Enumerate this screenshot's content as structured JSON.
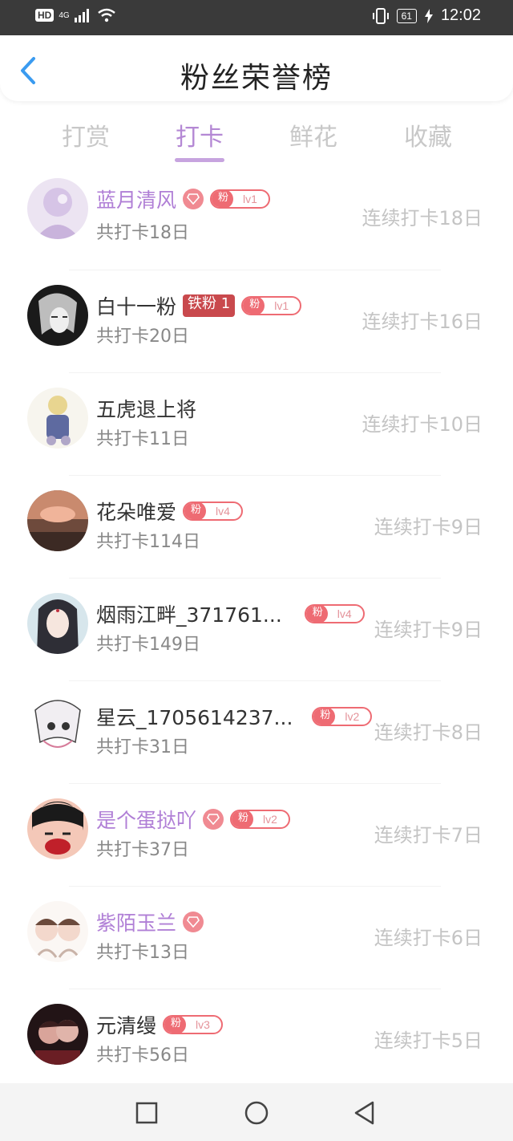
{
  "status_bar": {
    "hd_badge": "HD",
    "network": "4G",
    "battery": "61",
    "time": "12:02"
  },
  "header": {
    "title": "粉丝荣誉榜",
    "back_icon": "back-chevron-icon",
    "accent_color": "#3a9bf0"
  },
  "tabs": [
    {
      "label": "打赏"
    },
    {
      "label": "打卡"
    },
    {
      "label": "鲜花"
    },
    {
      "label": "收藏"
    }
  ],
  "active_tab": "打卡",
  "rows": [
    {
      "name": "蓝月清风",
      "name_color": "purple",
      "diamond": true,
      "fan_label": "粉",
      "fan_level": "lv1",
      "total": "共打卡18日",
      "streak": "连续打卡18日"
    },
    {
      "name": "白十一粉",
      "name_color": "normal",
      "tag": "铁粉 1",
      "fan_label": "粉",
      "fan_level": "lv1",
      "total": "共打卡20日",
      "streak": "连续打卡16日"
    },
    {
      "name": "五虎退上将",
      "name_color": "normal",
      "total": "共打卡11日",
      "streak": "连续打卡10日"
    },
    {
      "name": "花朵唯爱",
      "name_color": "normal",
      "fan_label": "粉",
      "fan_level": "lv4",
      "total": "共打卡114日",
      "streak": "连续打卡9日"
    },
    {
      "name": "烟雨江畔_371761...",
      "name_color": "normal",
      "fan_label": "粉",
      "fan_level": "lv4",
      "total": "共打卡149日",
      "streak": "连续打卡9日"
    },
    {
      "name": "星云_1705614237...",
      "name_color": "normal",
      "fan_label": "粉",
      "fan_level": "lv2",
      "total": "共打卡31日",
      "streak": "连续打卡8日"
    },
    {
      "name": "是个蛋挞吖",
      "name_color": "purple",
      "diamond": true,
      "fan_label": "粉",
      "fan_level": "lv2",
      "total": "共打卡37日",
      "streak": "连续打卡7日"
    },
    {
      "name": "紫陌玉兰",
      "name_color": "purple",
      "diamond": true,
      "total": "共打卡13日",
      "streak": "连续打卡6日"
    },
    {
      "name": "元清缦",
      "name_color": "normal",
      "fan_label": "粉",
      "fan_level": "lv3",
      "total": "共打卡56日",
      "streak": "连续打卡5日"
    }
  ],
  "nav_bar": {
    "recent_icon": "square-recent-icon",
    "home_icon": "circle-home-icon",
    "back_icon": "triangle-back-icon"
  }
}
